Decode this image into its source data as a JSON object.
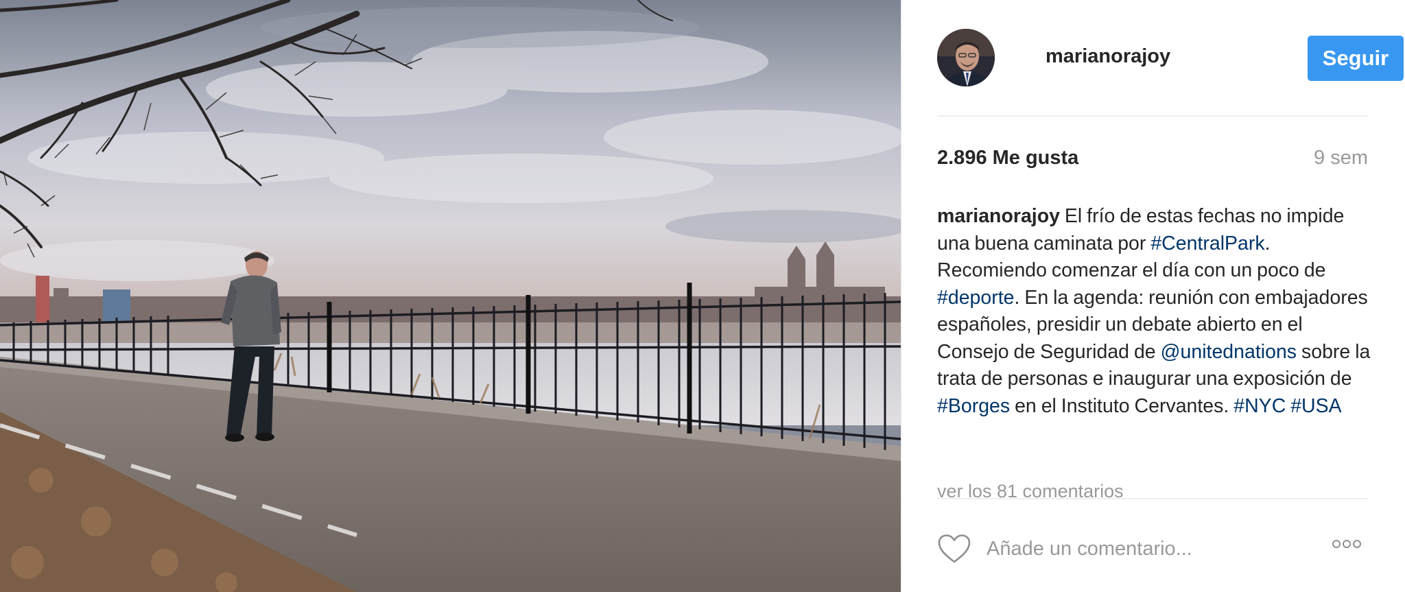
{
  "post": {
    "photo_alt": "marianorajoy",
    "colors": {
      "follow_button": "#3897f0",
      "hashtag": "#003569",
      "muted": "#999999",
      "text": "#262626"
    }
  },
  "header": {
    "username": "marianorajoy",
    "follow_label": "Seguir"
  },
  "stats": {
    "likes": "2.896 Me gusta",
    "time_ago": "9 sem"
  },
  "caption": {
    "user": "marianorajoy",
    "t1": " El frío de estas fechas no impide una buena caminata por ",
    "tag1": "#CentralPark",
    "t2": ". Recomiendo comenzar el día con un poco de ",
    "tag2": "#deporte",
    "t3": ". En la agenda: reunión con embajadores españoles, presidir un debate abierto en el Consejo de Seguridad de ",
    "mention": "@unitednations",
    "t4": " sobre la trata de personas e inaugurar una exposición de ",
    "tag3": "#Borges",
    "t5": " en el Instituto Cervantes. ",
    "tag4": "#NYC",
    "t6": " ",
    "tag5": "#USA"
  },
  "comments": {
    "view_all": "ver los 81 comentarios"
  },
  "footer": {
    "comment_placeholder": "Añade un comentario...",
    "like_icon": "heart-icon",
    "more_icon": "more-options-icon"
  }
}
